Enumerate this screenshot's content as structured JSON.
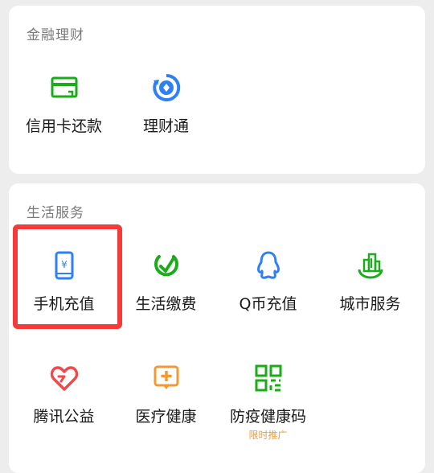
{
  "sections": {
    "finance": {
      "title": "金融理财",
      "items": [
        {
          "label": "信用卡还款",
          "icon": "credit-card-icon"
        },
        {
          "label": "理财通",
          "icon": "wealth-icon"
        }
      ]
    },
    "life": {
      "title": "生活服务",
      "items": [
        {
          "label": "手机充值",
          "icon": "mobile-topup-icon"
        },
        {
          "label": "生活缴费",
          "icon": "bill-payment-icon"
        },
        {
          "label": "Q币充值",
          "icon": "qq-penguin-icon"
        },
        {
          "label": "城市服务",
          "icon": "city-buildings-icon"
        },
        {
          "label": "腾讯公益",
          "icon": "charity-heart-icon"
        },
        {
          "label": "医疗健康",
          "icon": "medical-cross-icon"
        },
        {
          "label": "防疫健康码",
          "icon": "qr-code-icon",
          "badge": "限时推广"
        }
      ]
    }
  },
  "colors": {
    "green": "#1aad19",
    "blue": "#2f7ff5",
    "red": "#f04a4a",
    "orange": "#f29a30",
    "highlight": "#f53a3a"
  }
}
